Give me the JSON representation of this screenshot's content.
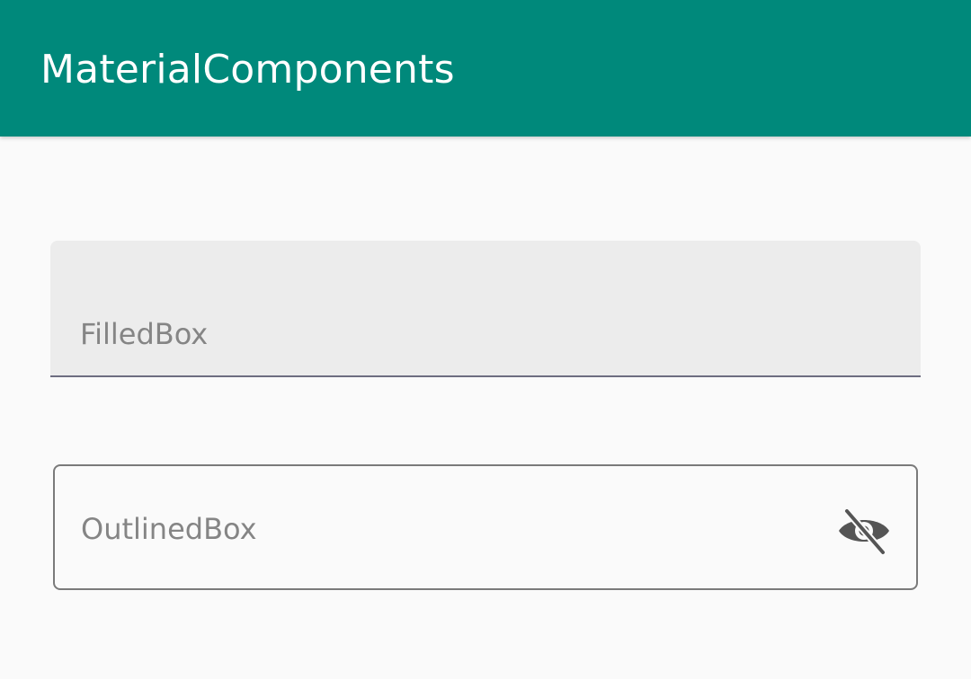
{
  "app_bar": {
    "title": "MaterialComponents",
    "color": "#00897b"
  },
  "filled_box": {
    "hint": "FilledBox",
    "value": ""
  },
  "outlined_box": {
    "hint": "OutlinedBox",
    "value": "",
    "end_icon": "visibility-off-icon"
  }
}
